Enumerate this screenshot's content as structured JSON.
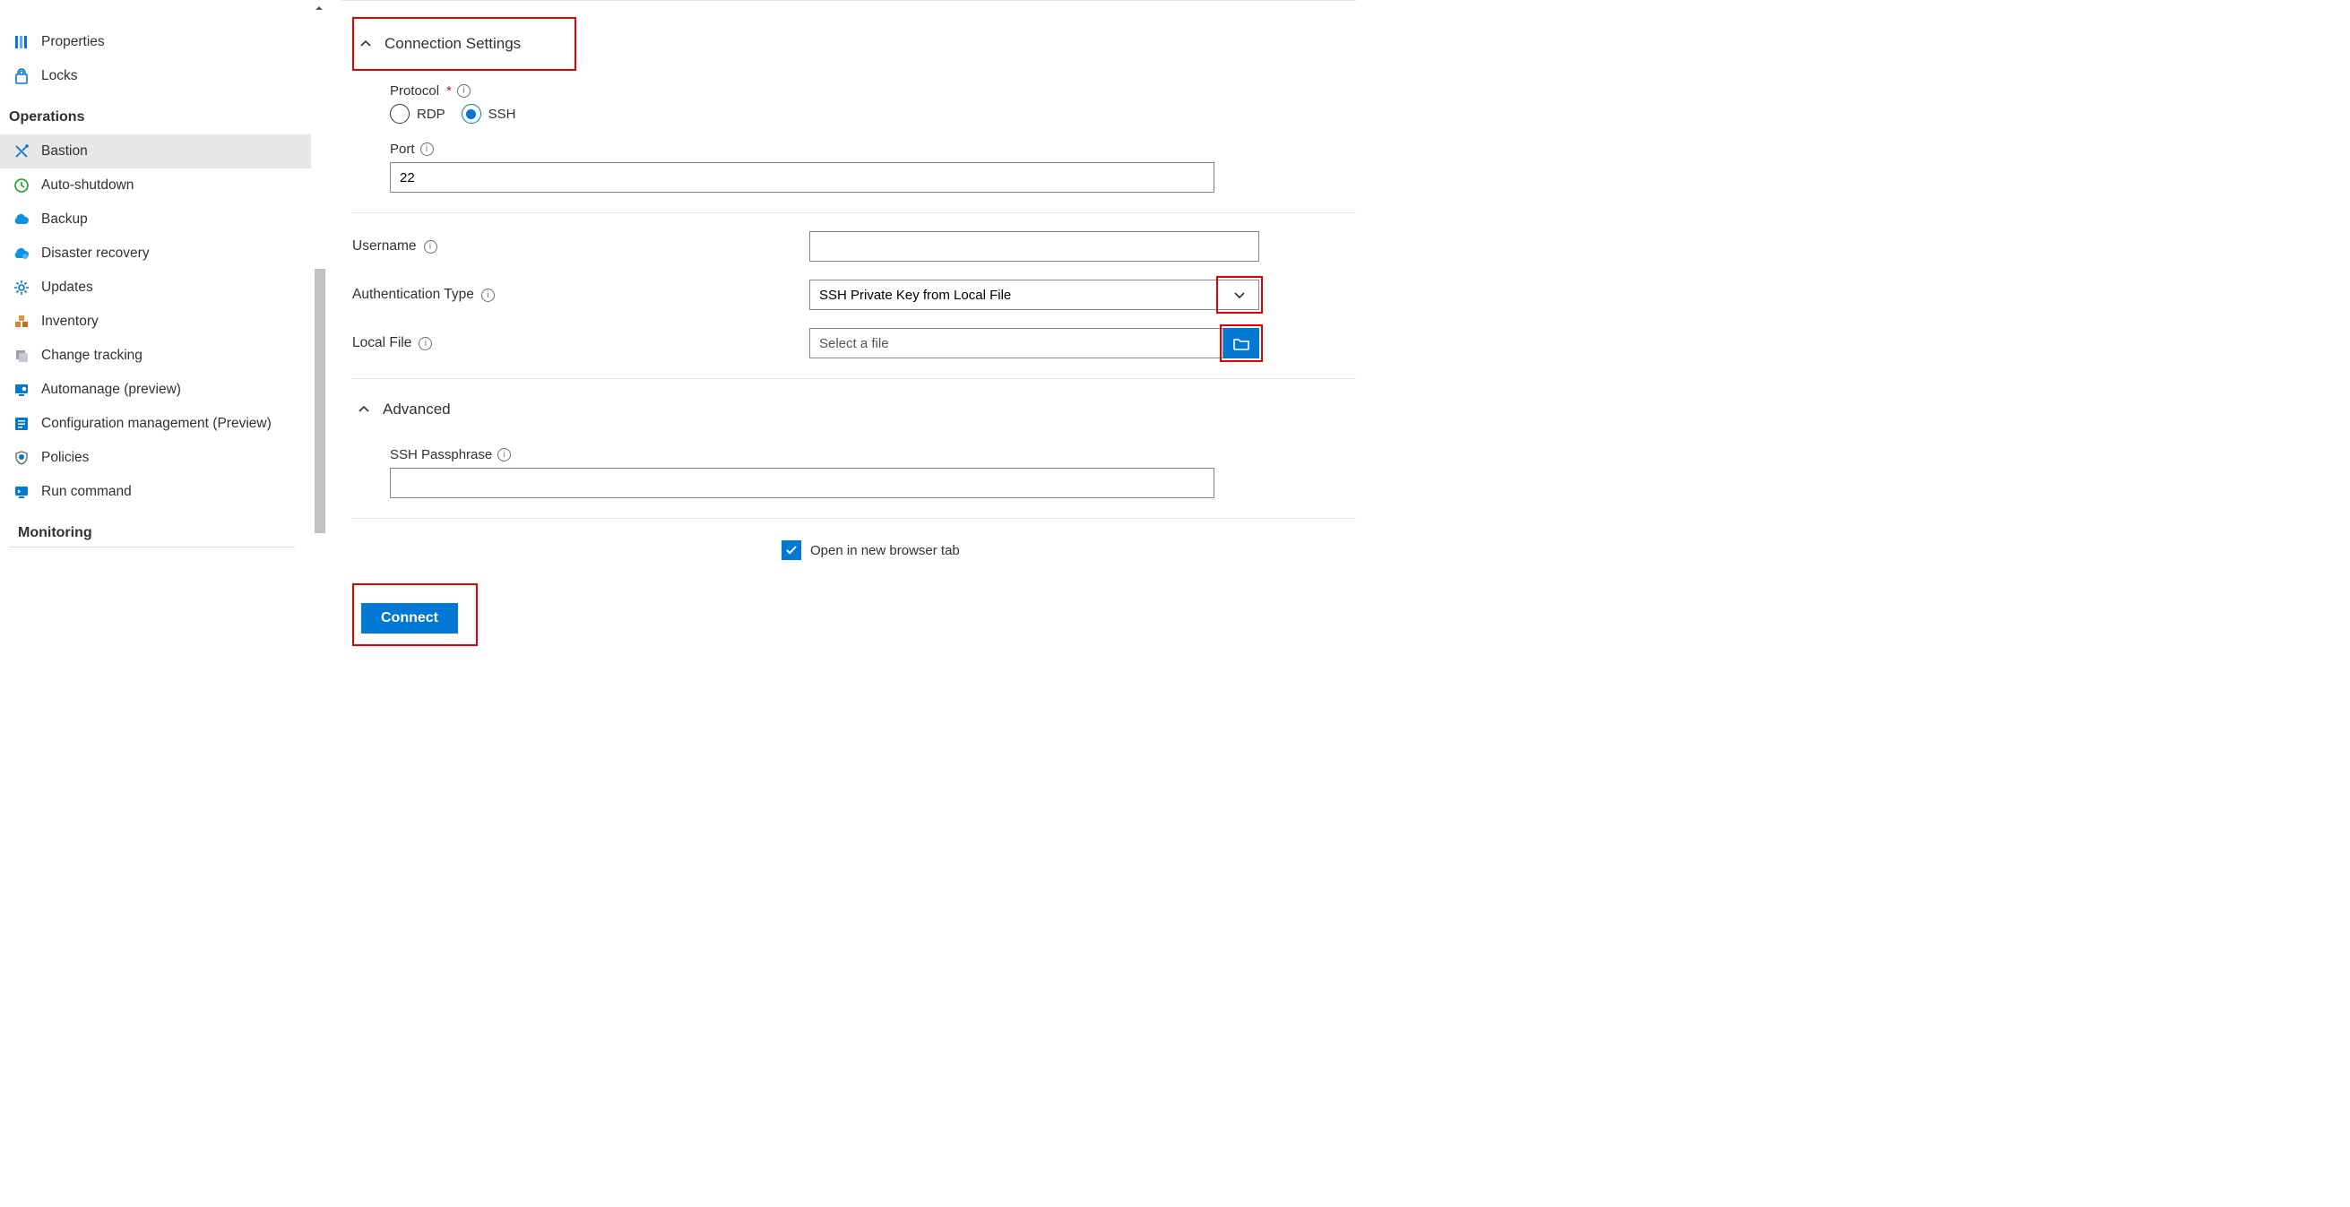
{
  "sidebar": {
    "properties": "Properties",
    "locks": "Locks",
    "sections": {
      "operations": "Operations",
      "monitoring": "Monitoring"
    },
    "operations_items": {
      "bastion": "Bastion",
      "auto_shutdown": "Auto-shutdown",
      "backup": "Backup",
      "disaster_recovery": "Disaster recovery",
      "updates": "Updates",
      "inventory": "Inventory",
      "change_tracking": "Change tracking",
      "automanage": "Automanage (preview)",
      "config_mgmt": "Configuration management (Preview)",
      "policies": "Policies",
      "run_command": "Run command"
    }
  },
  "main": {
    "conn_settings_title": "Connection Settings",
    "protocol_label": "Protocol",
    "protocol_options": {
      "rdp": "RDP",
      "ssh": "SSH"
    },
    "port_label": "Port",
    "port_value": "22",
    "username_label": "Username",
    "username_value": "",
    "auth_type_label": "Authentication Type",
    "auth_type_value": "SSH Private Key from Local File",
    "local_file_label": "Local File",
    "local_file_placeholder": "Select a file",
    "advanced_title": "Advanced",
    "ssh_passphrase_label": "SSH Passphrase",
    "ssh_passphrase_value": "",
    "open_new_tab_label": "Open in new browser tab",
    "connect_btn": "Connect"
  }
}
